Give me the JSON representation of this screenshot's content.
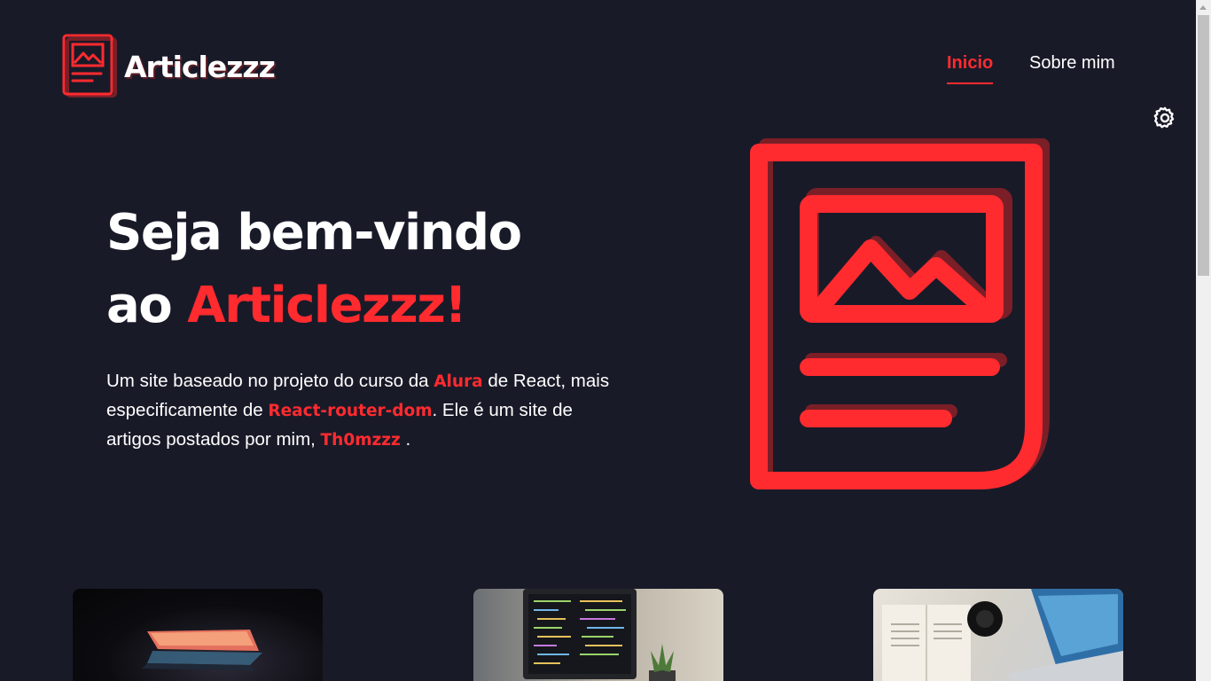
{
  "brand": {
    "name": "Articlezzz"
  },
  "nav": {
    "home": "Inicio",
    "about": "Sobre mim"
  },
  "hero": {
    "title_line1": "Seja bem-vindo",
    "title_prefix": "ao",
    "title_brand": "Articlezzz!",
    "desc_part1": "Um site baseado no projeto do curso da ",
    "desc_alura": "Alura",
    "desc_part2": " de React, mais especificamente de ",
    "desc_router": "React-router-dom",
    "desc_part3": ". Ele é um site de artigos postados por mim, ",
    "desc_author": "Th0mzzz",
    "desc_part4": " ."
  },
  "icons": {
    "logo": "article-image-icon",
    "settings": "gear-icon",
    "hero": "article-image-icon"
  },
  "colors": {
    "background": "#191a28",
    "accent": "#ff2b2f",
    "accent_shadow": "#7a1f27",
    "text": "#ffffff"
  }
}
